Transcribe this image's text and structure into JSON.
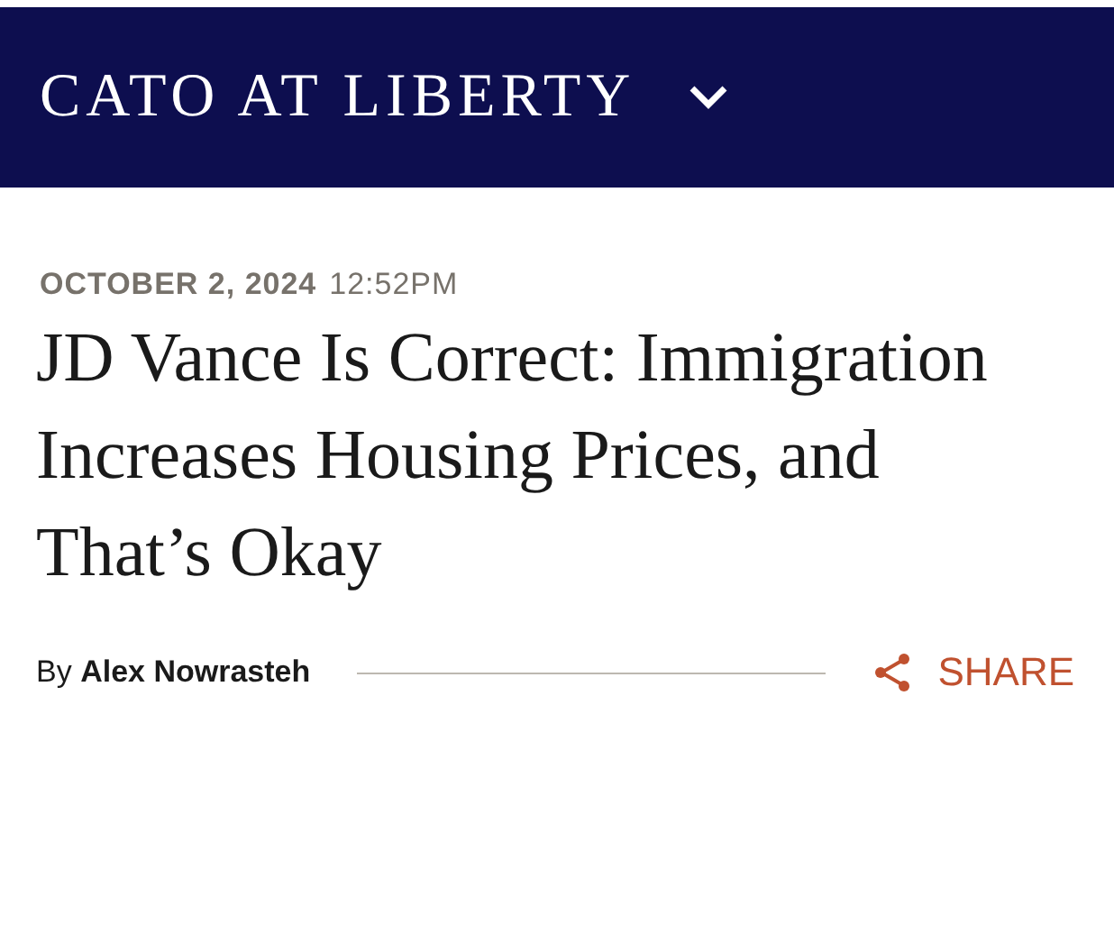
{
  "header": {
    "title": "CATO AT LIBERTY"
  },
  "article": {
    "date": "OCTOBER 2, 2024",
    "time": "12:52PM",
    "headline": "JD Vance Is Correct: Immigration Increases Housing Prices, and That’s Okay",
    "byline": "By **Alex Nowrasteh**",
    "share": "SHARE"
  }
}
